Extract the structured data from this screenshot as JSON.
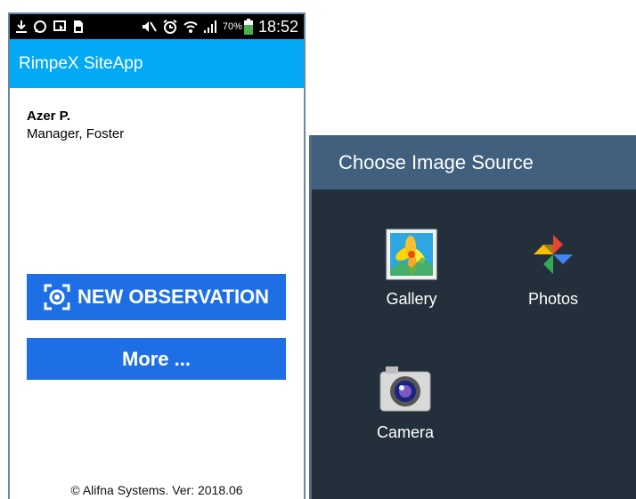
{
  "status_bar": {
    "battery_percent": "70%",
    "time": "18:52",
    "icons": [
      "download-icon",
      "whatsapp-icon",
      "cast-icon",
      "sim-icon",
      "mute-icon",
      "alarm-icon",
      "wifi-icon",
      "signal-icon",
      "battery-icon"
    ]
  },
  "app": {
    "title": "RimpeX SiteApp",
    "accent_color": "#03a9f4",
    "button_color": "#1e6fe6"
  },
  "user": {
    "name": "Azer P.",
    "role": "Manager, Foster"
  },
  "actions": {
    "new_observation_label": "NEW OBSERVATION",
    "more_label": "More ..."
  },
  "footer": {
    "copyright": "© Alifna Systems. Ver: 2018.06"
  },
  "dialog": {
    "title": "Choose Image Source",
    "options": [
      {
        "label": "Gallery",
        "icon": "gallery-icon"
      },
      {
        "label": "Photos",
        "icon": "photos-pinwheel-icon"
      },
      {
        "label": "Camera",
        "icon": "camera-icon"
      }
    ]
  }
}
